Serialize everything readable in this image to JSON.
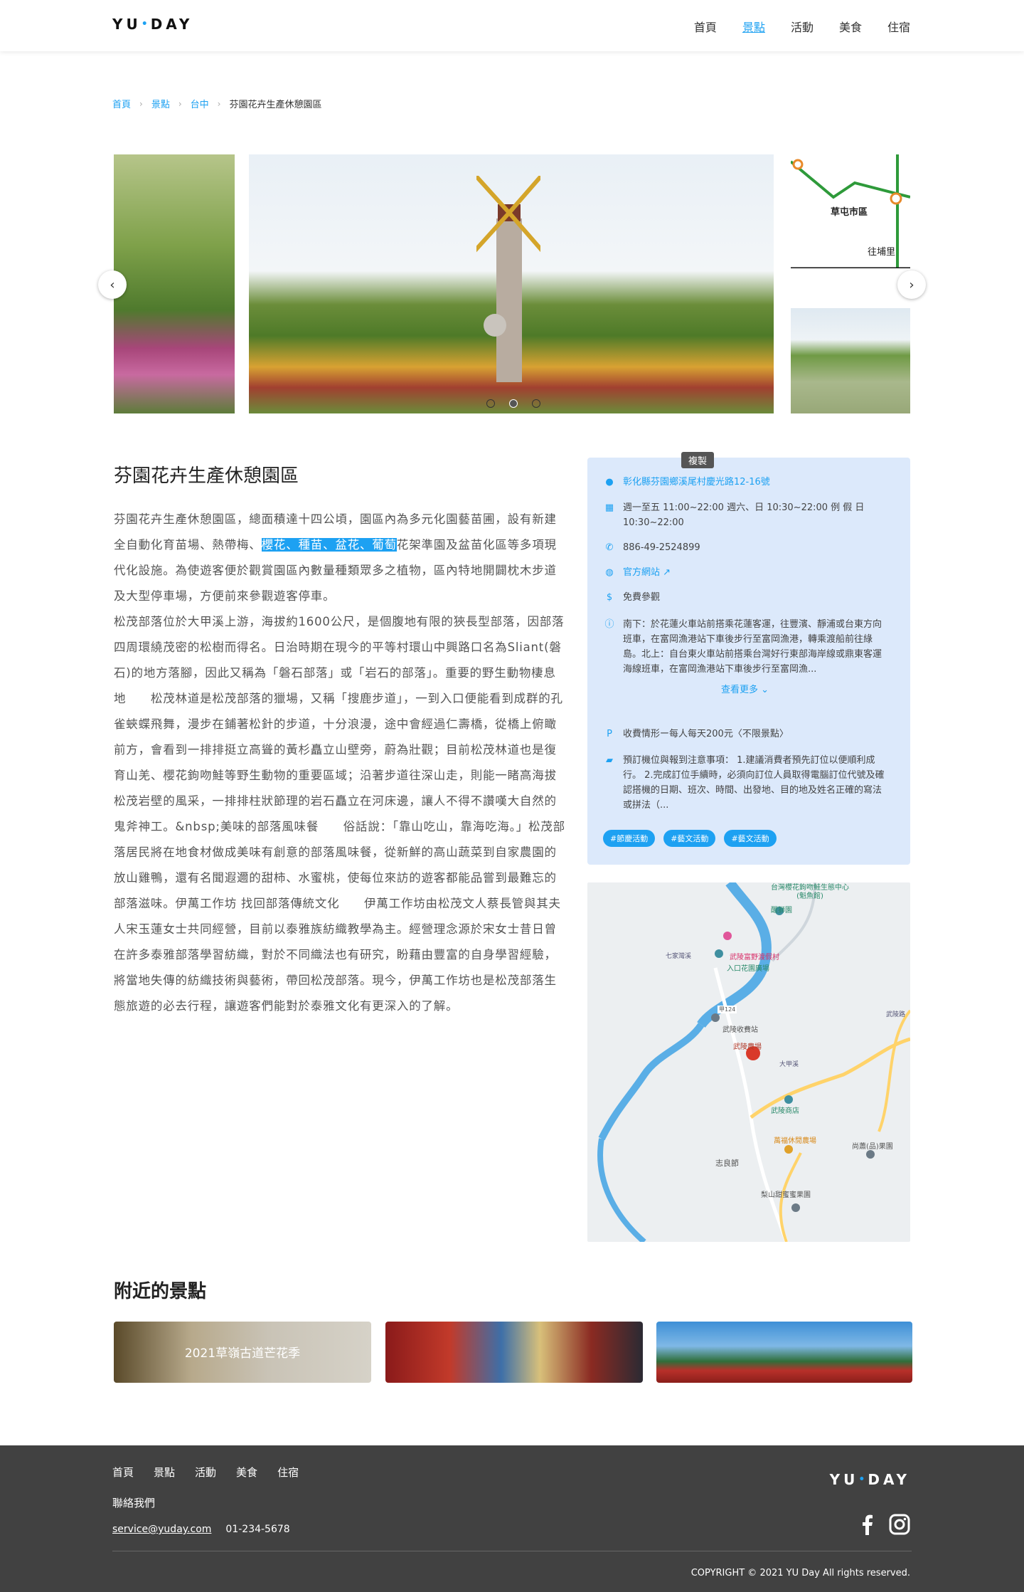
{
  "header": {
    "logo_left": "YU",
    "logo_dot": "•",
    "logo_right": "DAY",
    "nav": [
      "首頁",
      "景點",
      "活動",
      "美食",
      "住宿"
    ],
    "active_nav": "景點"
  },
  "breadcrumb": {
    "items": [
      "首頁",
      "景點",
      "台中"
    ],
    "current": "芬園花卉生產休憩園區"
  },
  "carousel": {
    "prev_icon": "chevron-left-icon",
    "next_icon": "chevron-right-icon",
    "dot_count": 3,
    "active_dot": 2,
    "map_thumb_labels": [
      "草屯市區",
      "往埔里"
    ]
  },
  "attraction": {
    "title": "芬園花卉生產休憩園區",
    "desc_before": "芬園花卉生產休憩園區，總面積達十四公頃，園區內為多元化園藝苗圃，設有新建全自動化育苗場、熱帶梅、",
    "desc_highlight": "櫻花、種苗、盆花、葡萄",
    "desc_after": "花架準園及盆苗化區等多項現代化設施。為使遊客便於觀賞園區內數量種類眾多之植物，區內特地開闢枕木步道及大型停車場，方便前來參觀遊客停車。\n松茂部落位於大甲溪上游，海拔約1600公尺，是個腹地有限的狹長型部落，因部落四周環繞茂密的松樹而得名。日治時期在現今的平等村環山中興路口名為Sliant(磐石)的地方落腳，因此又稱為「磐石部落」或「岩石的部落」。重要的野生動物棲息地　　松茂林道是松茂部落的獵場，又稱「搜鹿步道」，一到入口便能看到成群的孔雀蛺蝶飛舞，漫步在鋪著松針的步道，十分浪漫，途中會經過仁壽橋，從橋上俯瞰前方，會看到一排排挺立高聳的黃杉矗立山壁旁，蔚為壯觀；目前松茂林道也是復育山羌、櫻花鉤吻鮭等野生動物的重要區域；沿著步道往深山走，則能一睹高海拔松茂岩壁的風采，一排排柱狀節理的岩石矗立在河床邊，讓人不得不讚嘆大自然的鬼斧神工。&nbsp;美味的部落風味餐　　俗話說：「靠山吃山，靠海吃海。」松茂部落居民將在地食材做成美味有創意的部落風味餐，從新鮮的高山蔬菜到自家農園的放山雞鴨，還有名聞遐邇的甜柿、水蜜桃，使每位來訪的遊客都能品嘗到最難忘的部落滋味。伊萬工作坊 找回部落傳統文化　　伊萬工作坊由松茂文人蔡長管與其夫人宋玉蓮女士共同經營，目前以泰雅族紡織教學為主。經營理念源於宋女士昔日曾在許多泰雅部落學習紡織，對於不同織法也有研究，盼藉由豐富的自身學習經驗，將當地失傳的紡織技術與藝術，帶回松茂部落。現今，伊萬工作坊也是松茂部落生態旅遊的必去行程，讓遊客們能對於泰雅文化有更深入的了解。"
  },
  "info": {
    "copy_tip": "複製",
    "address": "彰化縣芬園鄉溪尾村慶光路12-16號",
    "hours": "週一至五 11:00~22:00 週六、日 10:30~22:00 例 假 日 10:30~22:00",
    "phone": "886-49-2524899",
    "website": "官方網站",
    "price": "免費參觀",
    "transport": "南下：於花蓮火車站前搭乘花蓮客運，往豐濱、靜浦或台東方向班車，在富岡漁港站下車後步行至富岡漁港，轉乘渡船前往綠島。北上：自台東火車站前搭乘台灣好行東部海岸線或鼎東客運海線班車，在富岡漁港站下車後步行至富岡漁...",
    "more": "查看更多",
    "parking": "收費情形ー每人每天200元〈不限景點〉",
    "notice": "預訂機位與報到注意事項： 1.建議消費者預先訂位以便順利成行。 2.完成訂位手續時，必須向訂位人員取得電腦訂位代號及確認搭機的日期、班次、時間、出發地、目的地及姓名正確的寫法或拼法（...",
    "tags": [
      "#節慶活動",
      "#藝文活動",
      "#藝文活動"
    ]
  },
  "map": {
    "labels": [
      "台灣櫻花鉤吻鮭生態中心(魁魚館)",
      "醒獅園",
      "七家灣溪",
      "武陵富野渡假村",
      "入口花園廣場",
      "武陵收費站",
      "武陵農場",
      "大甲溪",
      "武陵路",
      "武陵商店",
      "萬福休閒農場",
      "志良節",
      "尚蕭(品)果園",
      "梨山甜蜜蜜果園",
      "甲124"
    ]
  },
  "nearby": {
    "title": "附近的景點",
    "cards": [
      "2021草嶺古道芒花季",
      "",
      ""
    ]
  },
  "footer": {
    "nav": [
      "首頁",
      "景點",
      "活動",
      "美食",
      "住宿"
    ],
    "contact": "聯絡我們",
    "email": "service@yuday.com",
    "phone": "01-234-5678",
    "logo_left": "YU",
    "logo_dot": "•",
    "logo_right": "DAY",
    "social": [
      "facebook-icon",
      "instagram-icon"
    ],
    "copyright": "COPYRIGHT © 2021 YU Day All rights reserved."
  },
  "colors": {
    "accent": "#1da1f2",
    "info_bg": "#dce9fb",
    "footer_bg": "#414141"
  }
}
